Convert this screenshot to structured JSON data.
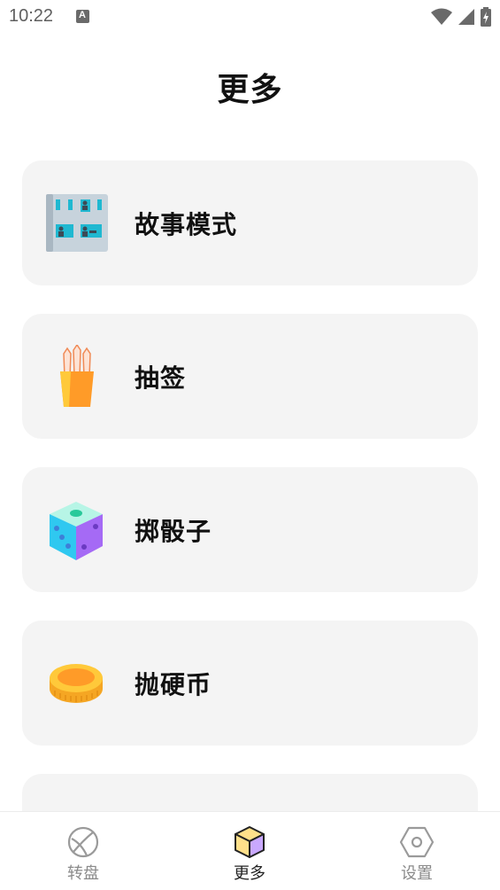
{
  "status_bar": {
    "time": "10:22",
    "notification_icon": "a-letter-icon",
    "wifi_icon": "wifi-icon",
    "signal_icon": "signal-icon",
    "battery_icon": "battery-charging-icon"
  },
  "header": {
    "title": "更多"
  },
  "menu": {
    "items": [
      {
        "label": "故事模式",
        "icon": "story-board-icon"
      },
      {
        "label": "抽签",
        "icon": "lottery-sticks-icon"
      },
      {
        "label": "掷骰子",
        "icon": "dice-icon"
      },
      {
        "label": "抛硬币",
        "icon": "coin-icon"
      },
      {
        "label": "",
        "icon": "clock-icon"
      }
    ]
  },
  "bottom_nav": {
    "items": [
      {
        "label": "转盘",
        "icon": "wheel-icon"
      },
      {
        "label": "更多",
        "icon": "cube-icon",
        "active": true
      },
      {
        "label": "设置",
        "icon": "settings-hexagon-icon"
      }
    ]
  },
  "colors": {
    "card_bg": "#f4f4f4",
    "nav_inactive": "#8a8a8a",
    "nav_active": "#222222"
  }
}
